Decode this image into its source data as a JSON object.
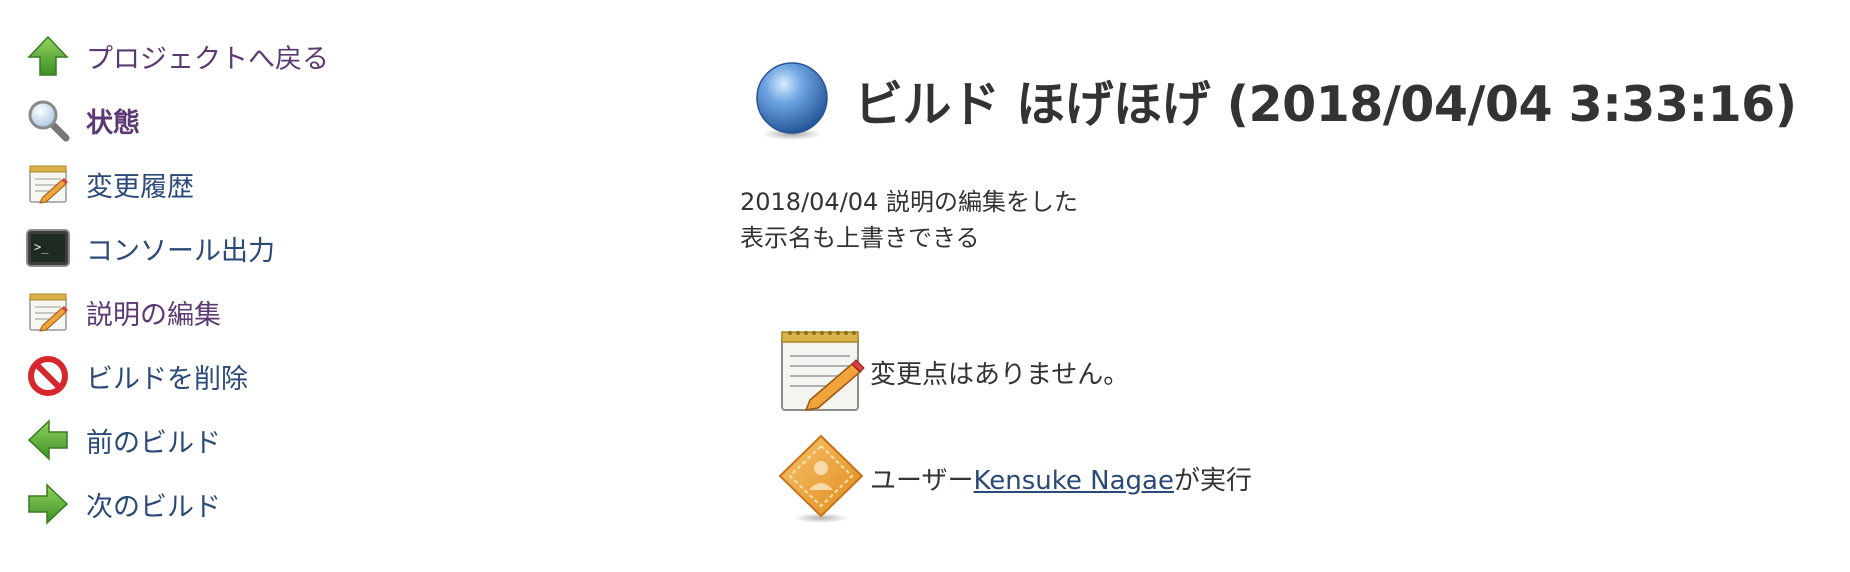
{
  "sidebar": {
    "items": [
      {
        "label": "プロジェクトへ戻る",
        "icon": "up-arrow-icon"
      },
      {
        "label": "状態",
        "icon": "search-icon"
      },
      {
        "label": "変更履歴",
        "icon": "notepad-icon"
      },
      {
        "label": "コンソール出力",
        "icon": "terminal-icon"
      },
      {
        "label": "説明の編集",
        "icon": "notepad-icon"
      },
      {
        "label": "ビルドを削除",
        "icon": "no-entry-icon"
      },
      {
        "label": "前のビルド",
        "icon": "left-arrow-icon"
      },
      {
        "label": "次のビルド",
        "icon": "right-arrow-icon"
      }
    ]
  },
  "main": {
    "title": "ビルド ほげほげ (2018/04/04 3:33:16)",
    "status_icon": "blue-ball-icon",
    "description": {
      "line1": "2018/04/04 説明の編集をした",
      "line2": "表示名も上書きできる"
    },
    "changes": {
      "text": "変更点はありません。",
      "icon": "notepad-icon"
    },
    "cause": {
      "prefix": "ユーザー",
      "user_link": "Kensuke Nagae",
      "suffix": "が実行",
      "icon": "user-diamond-icon"
    }
  },
  "colors": {
    "link": "#2b4a78",
    "visited_link": "#5b3a73",
    "title": "#333333",
    "green_arrow": "#5aaa3a",
    "status_blue": "#3a78c4"
  }
}
